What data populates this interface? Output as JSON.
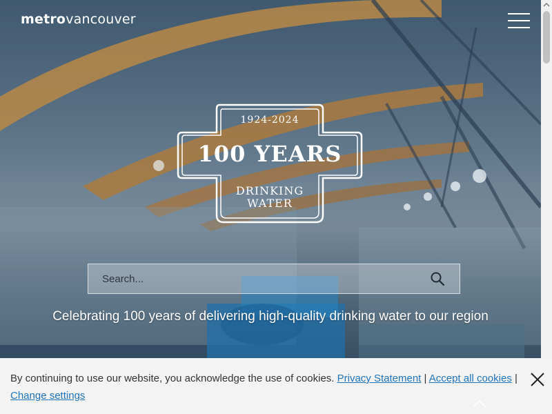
{
  "header": {
    "logo_bold": "metro",
    "logo_light": "vancouver",
    "menu_icon": "hamburger-menu-icon"
  },
  "badge": {
    "years_range": "1924-2024",
    "main": "100 YEARS",
    "sub_line1": "DRINKING",
    "sub_line2": "WATER"
  },
  "search": {
    "placeholder": "Search...",
    "icon": "search-icon"
  },
  "tagline": "Celebrating 100 years of delivering high-quality drinking water to our region",
  "cookie": {
    "text": "By continuing to use our website, you acknowledge the use of cookies.",
    "privacy_link": "Privacy Statement",
    "separator1": "|",
    "accept_link": "Accept all cookies",
    "separator2": "|",
    "settings_link": "Change settings",
    "close_icon": "close-icon"
  },
  "colors": {
    "link": "#1f73b8",
    "banner_bg": "#f3f3f3",
    "text_white": "#ffffff"
  }
}
